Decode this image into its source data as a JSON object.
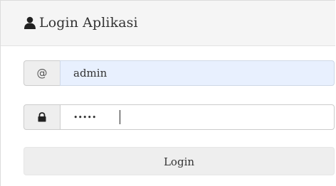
{
  "panel": {
    "title": "Login Aplikasi",
    "title_icon": "user-icon"
  },
  "username": {
    "addon_icon": "at-sign-icon",
    "addon_text": "@",
    "value": "admin"
  },
  "password": {
    "addon_icon": "lock-icon",
    "value": "•••••"
  },
  "submit": {
    "label": "Login"
  },
  "colors": {
    "heading_bg": "#f5f5f5",
    "autofill_bg": "#e8f0fe",
    "addon_bg": "#eeeeee",
    "button_bg": "#eeeeee",
    "text": "#333333"
  }
}
